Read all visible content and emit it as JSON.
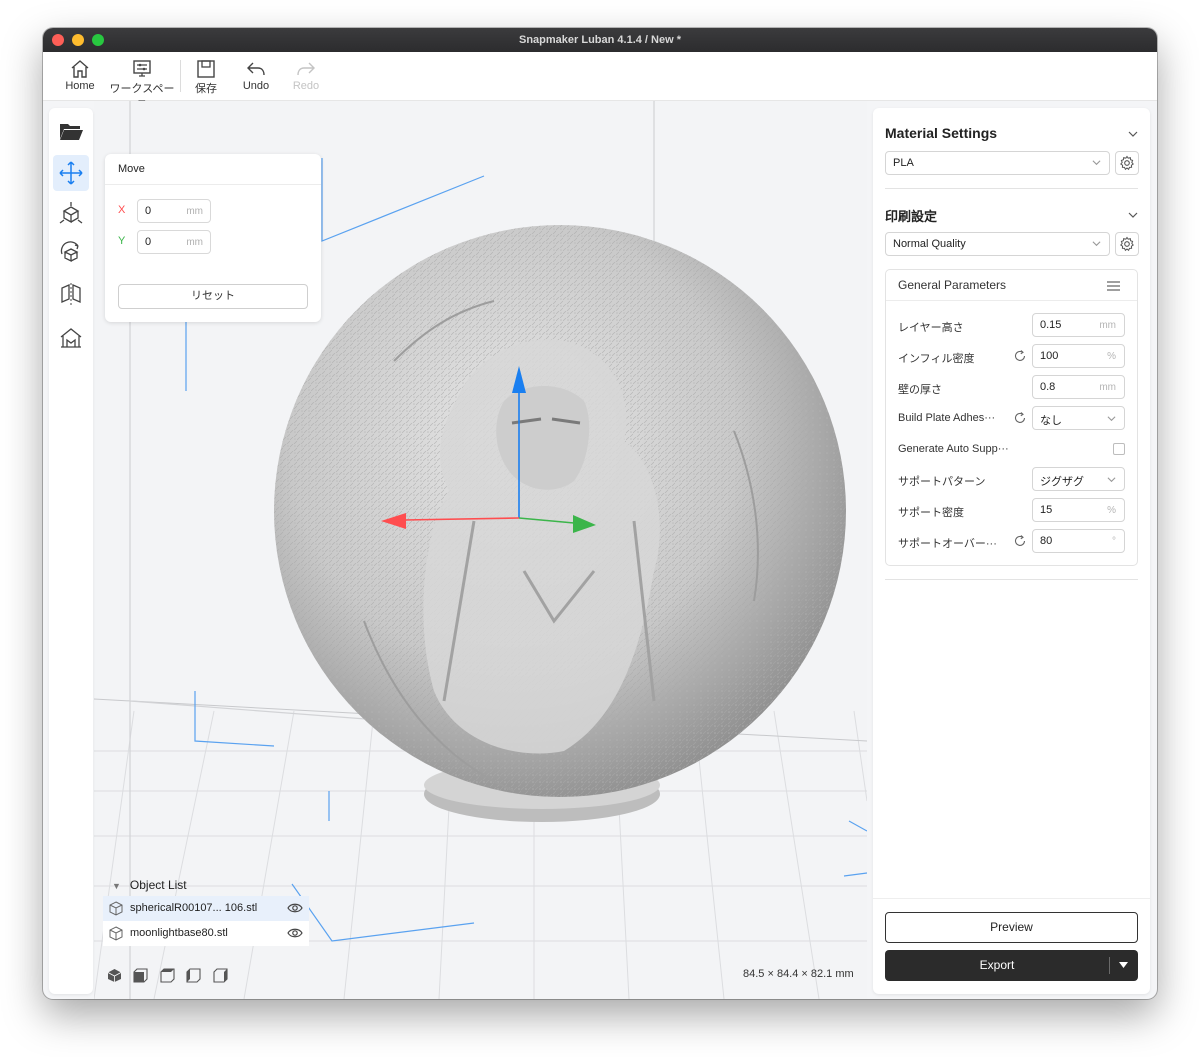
{
  "window": {
    "title": "Snapmaker Luban 4.1.4 / New *"
  },
  "toolbar": {
    "home": "Home",
    "workspace": "ワークスペース",
    "save": "保存",
    "undo": "Undo",
    "redo": "Redo"
  },
  "left_tools": [
    "open-folder-icon",
    "move-icon",
    "scale-icon",
    "rotate-icon",
    "mirror-icon",
    "support-icon"
  ],
  "move_panel": {
    "title": "Move",
    "x_label": "X",
    "x_value": "0",
    "y_label": "Y",
    "y_value": "0",
    "unit": "mm",
    "reset": "リセット"
  },
  "object_list": {
    "title": "Object List",
    "items": [
      {
        "name": "sphericalR00107... 106.stl",
        "selected": true
      },
      {
        "name": "moonlightbase80.stl",
        "selected": false
      }
    ]
  },
  "dimensions": "84.5 × 84.4 × 82.1 mm",
  "material": {
    "title": "Material Settings",
    "selected": "PLA"
  },
  "print_settings": {
    "title": "印刷設定",
    "selected": "Normal Quality"
  },
  "general_parameters": {
    "title": "General Parameters",
    "params": [
      {
        "label": "レイヤー高さ",
        "value": "0.15",
        "unit": "mm"
      },
      {
        "label": "インフィル密度",
        "value": "100",
        "unit": "%"
      },
      {
        "label": "壁の厚さ",
        "value": "0.8",
        "unit": "mm"
      },
      {
        "label": "Build Plate Adhes···",
        "value": "なし"
      },
      {
        "label": "Generate Auto Supp···"
      },
      {
        "label": "サポートパターン",
        "value": "ジグザグ"
      },
      {
        "label": "サポート密度",
        "value": "15",
        "unit": "%"
      },
      {
        "label": "サポートオーバー···",
        "value": "80",
        "unit": "°"
      }
    ]
  },
  "actions": {
    "preview": "Preview",
    "export": "Export"
  },
  "colors": {
    "accent": "#1a7ff0",
    "axis_x": "#ff4d4f",
    "axis_y": "#3bb54a",
    "axis_z": "#1a7ff0",
    "export_bg": "#2b2b2b"
  }
}
